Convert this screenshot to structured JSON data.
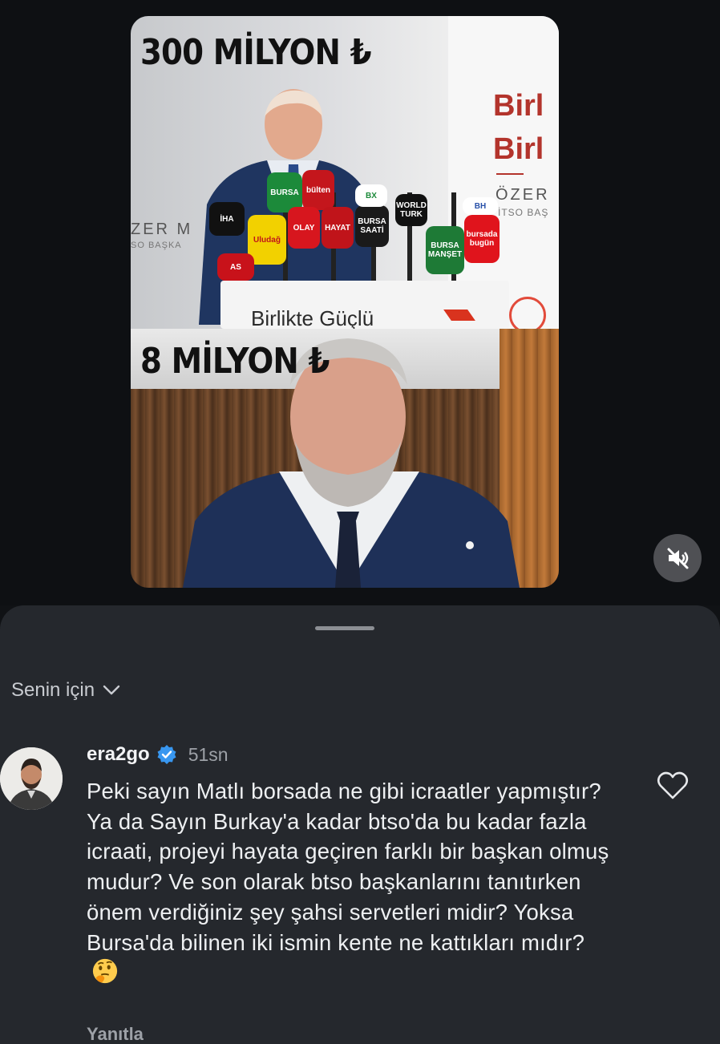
{
  "media": {
    "top_caption": "300 MİLYON ₺",
    "bottom_caption": "8 MİLYON ₺",
    "banner_line1": "Birl",
    "banner_line2": "Birl",
    "banner_name": "ÖZER",
    "banner_subtitle": "İTSO BAŞ",
    "wall_name": "ZER M",
    "wall_subtitle": "SO BAŞKA",
    "podium_text": "Birlikte Güçlü",
    "mic_labels": [
      "BURSA",
      "bülten",
      "İHA",
      "Uludağ",
      "OLAY",
      "HAYAT",
      "BURSA SAATİ",
      "BURSA MANŞET",
      "bursada bugün",
      "BH",
      "AS",
      "BX",
      "WORLD TURK"
    ]
  },
  "controls": {
    "mute_icon": "volume-muted-icon"
  },
  "comments": {
    "filter_label": "Senin için",
    "items": [
      {
        "username": "era2go",
        "verified": true,
        "time": "51sn",
        "text": "Peki sayın Matlı borsada ne gibi icraatler yapmıştır? Ya da Sayın Burkay'a kadar btso'da bu kadar fazla icraati, projeyi hayata geçiren farklı bir başkan olmuş mudur? Ve son olarak btso başkanlarını tanıtırken önem verdiğiniz şey şahsi servetleri midir? Yoksa Bursa'da bilinen iki ismin kente ne kattıkları mıdır?",
        "emoji": "thinking-face",
        "reply_label": "Yanıtla"
      }
    ]
  },
  "colors": {
    "sheet_bg": "#25282d",
    "page_bg": "#101215",
    "verified_blue": "#3897f0"
  }
}
